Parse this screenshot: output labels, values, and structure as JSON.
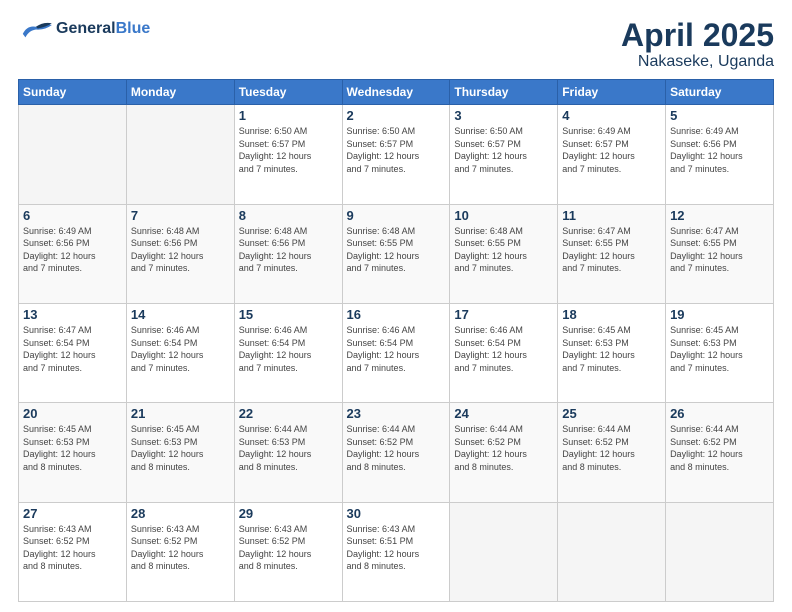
{
  "logo": {
    "line1": "General",
    "line2": "Blue"
  },
  "title": "April 2025",
  "subtitle": "Nakaseke, Uganda",
  "days_of_week": [
    "Sunday",
    "Monday",
    "Tuesday",
    "Wednesday",
    "Thursday",
    "Friday",
    "Saturday"
  ],
  "weeks": [
    [
      {
        "day": "",
        "info": ""
      },
      {
        "day": "",
        "info": ""
      },
      {
        "day": "1",
        "info": "Sunrise: 6:50 AM\nSunset: 6:57 PM\nDaylight: 12 hours\nand 7 minutes."
      },
      {
        "day": "2",
        "info": "Sunrise: 6:50 AM\nSunset: 6:57 PM\nDaylight: 12 hours\nand 7 minutes."
      },
      {
        "day": "3",
        "info": "Sunrise: 6:50 AM\nSunset: 6:57 PM\nDaylight: 12 hours\nand 7 minutes."
      },
      {
        "day": "4",
        "info": "Sunrise: 6:49 AM\nSunset: 6:57 PM\nDaylight: 12 hours\nand 7 minutes."
      },
      {
        "day": "5",
        "info": "Sunrise: 6:49 AM\nSunset: 6:56 PM\nDaylight: 12 hours\nand 7 minutes."
      }
    ],
    [
      {
        "day": "6",
        "info": "Sunrise: 6:49 AM\nSunset: 6:56 PM\nDaylight: 12 hours\nand 7 minutes."
      },
      {
        "day": "7",
        "info": "Sunrise: 6:48 AM\nSunset: 6:56 PM\nDaylight: 12 hours\nand 7 minutes."
      },
      {
        "day": "8",
        "info": "Sunrise: 6:48 AM\nSunset: 6:56 PM\nDaylight: 12 hours\nand 7 minutes."
      },
      {
        "day": "9",
        "info": "Sunrise: 6:48 AM\nSunset: 6:55 PM\nDaylight: 12 hours\nand 7 minutes."
      },
      {
        "day": "10",
        "info": "Sunrise: 6:48 AM\nSunset: 6:55 PM\nDaylight: 12 hours\nand 7 minutes."
      },
      {
        "day": "11",
        "info": "Sunrise: 6:47 AM\nSunset: 6:55 PM\nDaylight: 12 hours\nand 7 minutes."
      },
      {
        "day": "12",
        "info": "Sunrise: 6:47 AM\nSunset: 6:55 PM\nDaylight: 12 hours\nand 7 minutes."
      }
    ],
    [
      {
        "day": "13",
        "info": "Sunrise: 6:47 AM\nSunset: 6:54 PM\nDaylight: 12 hours\nand 7 minutes."
      },
      {
        "day": "14",
        "info": "Sunrise: 6:46 AM\nSunset: 6:54 PM\nDaylight: 12 hours\nand 7 minutes."
      },
      {
        "day": "15",
        "info": "Sunrise: 6:46 AM\nSunset: 6:54 PM\nDaylight: 12 hours\nand 7 minutes."
      },
      {
        "day": "16",
        "info": "Sunrise: 6:46 AM\nSunset: 6:54 PM\nDaylight: 12 hours\nand 7 minutes."
      },
      {
        "day": "17",
        "info": "Sunrise: 6:46 AM\nSunset: 6:54 PM\nDaylight: 12 hours\nand 7 minutes."
      },
      {
        "day": "18",
        "info": "Sunrise: 6:45 AM\nSunset: 6:53 PM\nDaylight: 12 hours\nand 7 minutes."
      },
      {
        "day": "19",
        "info": "Sunrise: 6:45 AM\nSunset: 6:53 PM\nDaylight: 12 hours\nand 7 minutes."
      }
    ],
    [
      {
        "day": "20",
        "info": "Sunrise: 6:45 AM\nSunset: 6:53 PM\nDaylight: 12 hours\nand 8 minutes."
      },
      {
        "day": "21",
        "info": "Sunrise: 6:45 AM\nSunset: 6:53 PM\nDaylight: 12 hours\nand 8 minutes."
      },
      {
        "day": "22",
        "info": "Sunrise: 6:44 AM\nSunset: 6:53 PM\nDaylight: 12 hours\nand 8 minutes."
      },
      {
        "day": "23",
        "info": "Sunrise: 6:44 AM\nSunset: 6:52 PM\nDaylight: 12 hours\nand 8 minutes."
      },
      {
        "day": "24",
        "info": "Sunrise: 6:44 AM\nSunset: 6:52 PM\nDaylight: 12 hours\nand 8 minutes."
      },
      {
        "day": "25",
        "info": "Sunrise: 6:44 AM\nSunset: 6:52 PM\nDaylight: 12 hours\nand 8 minutes."
      },
      {
        "day": "26",
        "info": "Sunrise: 6:44 AM\nSunset: 6:52 PM\nDaylight: 12 hours\nand 8 minutes."
      }
    ],
    [
      {
        "day": "27",
        "info": "Sunrise: 6:43 AM\nSunset: 6:52 PM\nDaylight: 12 hours\nand 8 minutes."
      },
      {
        "day": "28",
        "info": "Sunrise: 6:43 AM\nSunset: 6:52 PM\nDaylight: 12 hours\nand 8 minutes."
      },
      {
        "day": "29",
        "info": "Sunrise: 6:43 AM\nSunset: 6:52 PM\nDaylight: 12 hours\nand 8 minutes."
      },
      {
        "day": "30",
        "info": "Sunrise: 6:43 AM\nSunset: 6:51 PM\nDaylight: 12 hours\nand 8 minutes."
      },
      {
        "day": "",
        "info": ""
      },
      {
        "day": "",
        "info": ""
      },
      {
        "day": "",
        "info": ""
      }
    ]
  ]
}
